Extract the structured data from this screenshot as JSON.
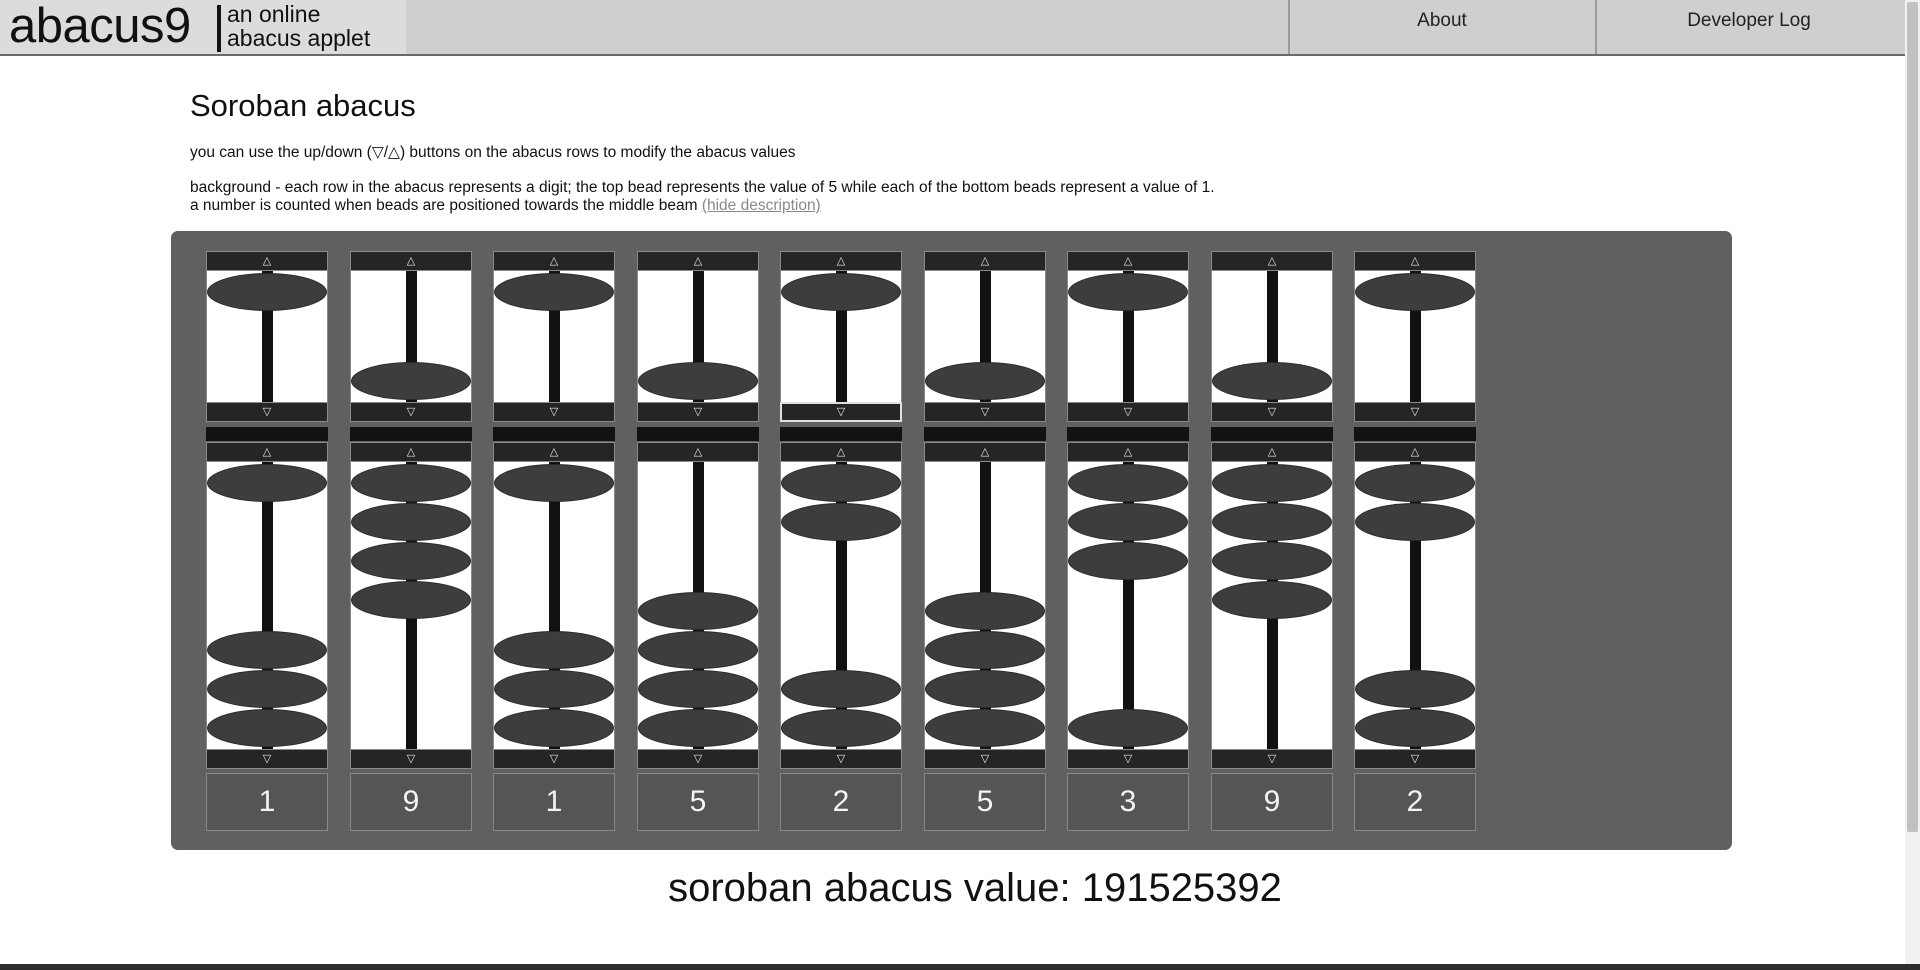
{
  "header": {
    "logo": "abacus9",
    "tagline_line1": "an online",
    "tagline_line2": "abacus applet",
    "nav": {
      "about": "About",
      "developer_log": "Developer Log"
    }
  },
  "main": {
    "title": "Soroban abacus",
    "instruction": "you can use the up/down (▽/△) buttons on the abacus rows to modify the abacus values",
    "background_line1": "background - each row in the abacus represents a digit; the top bead represents the value of 5 while each of the bottom beads represent a value of 1.",
    "background_line2": "a number is counted when beads are positioned towards the middle beam",
    "hide_link": "(hide description)"
  },
  "abacus": {
    "up_glyph": "△",
    "down_glyph": "▽",
    "digits": [
      1,
      9,
      1,
      5,
      2,
      5,
      3,
      9,
      2
    ],
    "focused_control": {
      "column": 4,
      "control": "upper-down"
    }
  },
  "result": {
    "label": "soroban abacus value:",
    "value": "191525392"
  },
  "colors": {
    "header_bg": "#cfcfcf",
    "frame_bg": "#606060",
    "bead": "#3d3d3d",
    "button_bg": "#252525",
    "digit_bg": "#555555"
  }
}
